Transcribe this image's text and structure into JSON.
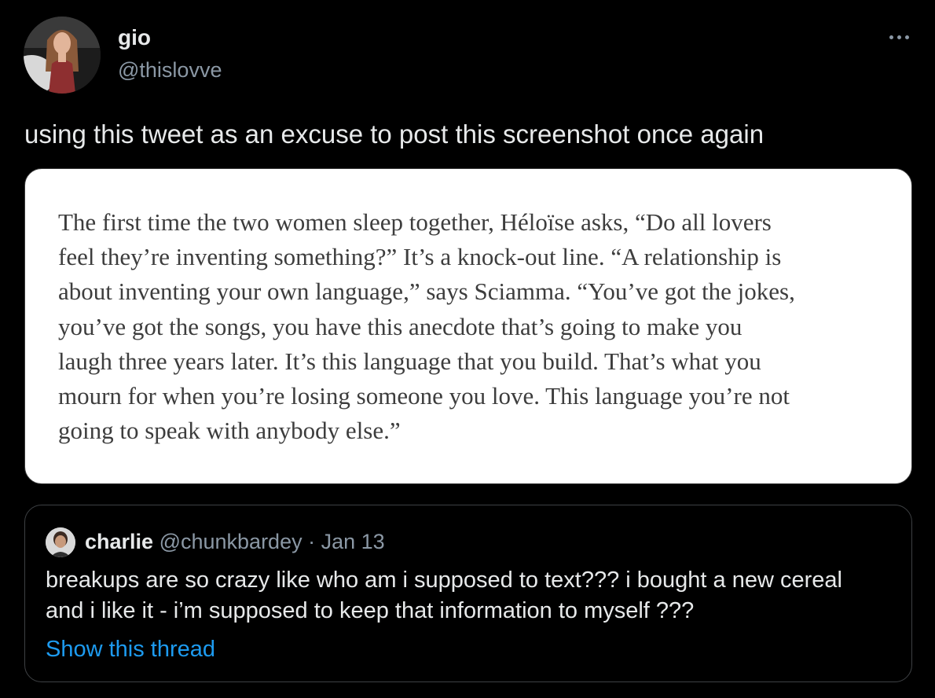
{
  "author": {
    "display_name": "gio",
    "handle": "@thislovve",
    "avatar_icon": "profile-photo"
  },
  "more_icon": "more-options-icon",
  "tweet": {
    "text": "using this tweet as an excuse to post this screenshot once again"
  },
  "media": {
    "lines": [
      "The first time the two women sleep together, Héloïse asks, “Do all lovers",
      "feel they’re inventing something?” It’s a knock-out line. “A relationship is",
      "about inventing your own language,” says Sciamma. “You’ve got the jokes,",
      "you’ve got the songs, you have this anecdote that’s going to make you",
      "laugh three years later. It’s this language that you build. That’s what you",
      "mourn for when you’re losing someone you love. This language you’re not",
      "going to speak with anybody else.”"
    ]
  },
  "quote": {
    "display_name": "charlie",
    "handle": "@chunkbardey",
    "separator": "·",
    "date": "Jan 13",
    "lines": [
      "breakups are so crazy like who am i supposed to text??? i bought a new cereal",
      "and i like it - i’m supposed to keep that information to myself ???"
    ],
    "show_thread": "Show this thread"
  },
  "colors": {
    "background": "#000000",
    "primary_text": "#e7e9ea",
    "secondary_text": "#8b98a5",
    "link": "#1d9bf0",
    "media_text": "#3d3d3d"
  }
}
